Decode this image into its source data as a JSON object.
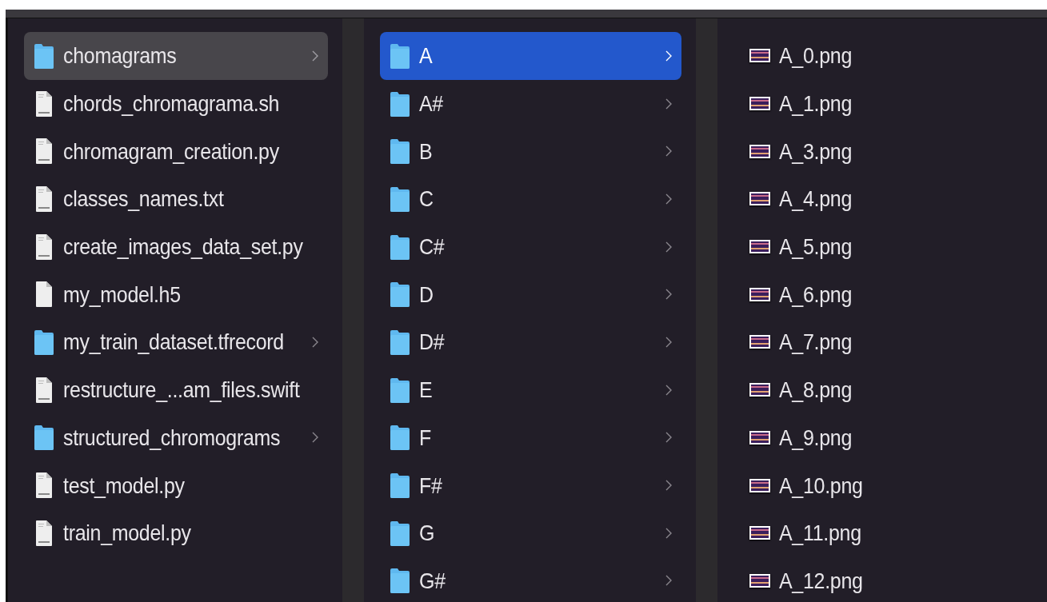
{
  "columns": [
    {
      "items": [
        {
          "kind": "folder",
          "name": "chomagrams",
          "selected": true,
          "focused": false
        },
        {
          "kind": "file",
          "name": "chords_chromagrama.sh",
          "selected": false,
          "focused": false
        },
        {
          "kind": "file",
          "name": "chromagram_creation.py",
          "selected": false,
          "focused": false
        },
        {
          "kind": "file",
          "name": "classes_names.txt",
          "selected": false,
          "focused": false
        },
        {
          "kind": "file",
          "name": "create_images_data_set.py",
          "selected": false,
          "focused": false
        },
        {
          "kind": "blank",
          "name": "my_model.h5",
          "selected": false,
          "focused": false
        },
        {
          "kind": "folder",
          "name": "my_train_dataset.tfrecord",
          "selected": false,
          "focused": false
        },
        {
          "kind": "file",
          "name": "restructure_...am_files.swift",
          "selected": false,
          "focused": false
        },
        {
          "kind": "folder",
          "name": "structured_chromograms",
          "selected": false,
          "focused": false
        },
        {
          "kind": "file",
          "name": "test_model.py",
          "selected": false,
          "focused": false
        },
        {
          "kind": "file",
          "name": "train_model.py",
          "selected": false,
          "focused": false
        }
      ]
    },
    {
      "items": [
        {
          "kind": "folder",
          "name": "A",
          "selected": true,
          "focused": true
        },
        {
          "kind": "folder",
          "name": "A#",
          "selected": false,
          "focused": false
        },
        {
          "kind": "folder",
          "name": "B",
          "selected": false,
          "focused": false
        },
        {
          "kind": "folder",
          "name": "C",
          "selected": false,
          "focused": false
        },
        {
          "kind": "folder",
          "name": "C#",
          "selected": false,
          "focused": false
        },
        {
          "kind": "folder",
          "name": "D",
          "selected": false,
          "focused": false
        },
        {
          "kind": "folder",
          "name": "D#",
          "selected": false,
          "focused": false
        },
        {
          "kind": "folder",
          "name": "E",
          "selected": false,
          "focused": false
        },
        {
          "kind": "folder",
          "name": "F",
          "selected": false,
          "focused": false
        },
        {
          "kind": "folder",
          "name": "F#",
          "selected": false,
          "focused": false
        },
        {
          "kind": "folder",
          "name": "G",
          "selected": false,
          "focused": false
        },
        {
          "kind": "folder",
          "name": "G#",
          "selected": false,
          "focused": false
        }
      ]
    },
    {
      "items": [
        {
          "kind": "image",
          "name": "A_0.png",
          "selected": false,
          "focused": false
        },
        {
          "kind": "image",
          "name": "A_1.png",
          "selected": false,
          "focused": false
        },
        {
          "kind": "image",
          "name": "A_3.png",
          "selected": false,
          "focused": false
        },
        {
          "kind": "image",
          "name": "A_4.png",
          "selected": false,
          "focused": false
        },
        {
          "kind": "image",
          "name": "A_5.png",
          "selected": false,
          "focused": false
        },
        {
          "kind": "image",
          "name": "A_6.png",
          "selected": false,
          "focused": false
        },
        {
          "kind": "image",
          "name": "A_7.png",
          "selected": false,
          "focused": false
        },
        {
          "kind": "image",
          "name": "A_8.png",
          "selected": false,
          "focused": false
        },
        {
          "kind": "image",
          "name": "A_9.png",
          "selected": false,
          "focused": false
        },
        {
          "kind": "image",
          "name": "A_10.png",
          "selected": false,
          "focused": false
        },
        {
          "kind": "image",
          "name": "A_11.png",
          "selected": false,
          "focused": false
        },
        {
          "kind": "image",
          "name": "A_12.png",
          "selected": false,
          "focused": false
        }
      ]
    }
  ]
}
